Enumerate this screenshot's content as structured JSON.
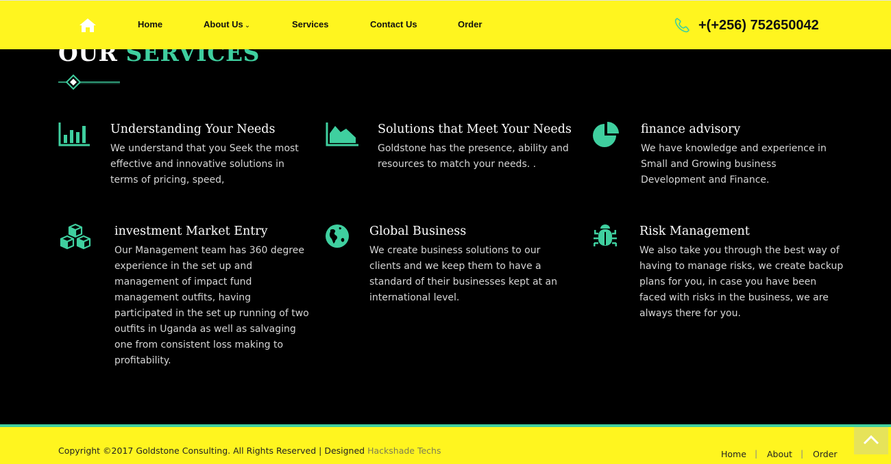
{
  "header": {
    "nav": [
      {
        "label": "Home"
      },
      {
        "label": "About Us",
        "has_dropdown": true
      },
      {
        "label": "Services"
      },
      {
        "label": "Contact Us"
      },
      {
        "label": "Order"
      }
    ],
    "phone": "+(+256) 752650042",
    "home_icon": "home-icon",
    "phone_icon": "phone-icon"
  },
  "section": {
    "title_part1": "OUR",
    "title_part2": "SERVICES"
  },
  "services": [
    {
      "title": "Understanding Your Needs",
      "desc": "We understand that you Seek the most effective and innovative solutions in terms of pricing, speed,",
      "icon": "bar-chart-icon"
    },
    {
      "title": "Solutions that Meet Your Needs",
      "desc": "Goldstone has the presence, ability and resources to match your needs. .",
      "icon": "area-chart-icon"
    },
    {
      "title": "finance advisory",
      "desc": "We have knowledge and experience in Small and Growing business Development and Finance.",
      "icon": "pie-chart-icon"
    },
    {
      "title": "investment Market Entry",
      "desc": "Our Management team has 360 degree experience in the set up and management of impact fund management outfits, having participated in the set up running of two outfits in Uganda as well as salvaging one from consistent loss making to profitability.",
      "icon": "cubes-icon"
    },
    {
      "title": "Global Business",
      "desc": "We create business solutions to our clients and we keep them to have a standard of their businesses kept at an international level.",
      "icon": "globe-icon"
    },
    {
      "title": "Risk Management",
      "desc": "We also take you through the best way of having to manage risks, we create backup plans for you, in case you have been faced with risks in the business, we are always there for you.",
      "icon": "bug-icon"
    }
  ],
  "footer": {
    "copyright": "Copyright ©2017 Goldstone Consulting. All Rights Reserved | Designed",
    "designer": "Hackshade Techs",
    "links": [
      {
        "label": "Home"
      },
      {
        "label": "About"
      },
      {
        "label": "Order"
      }
    ],
    "separator": "|"
  },
  "colors": {
    "accent": "#3fcf9f",
    "bar": "#fff51f",
    "background": "#000000"
  }
}
